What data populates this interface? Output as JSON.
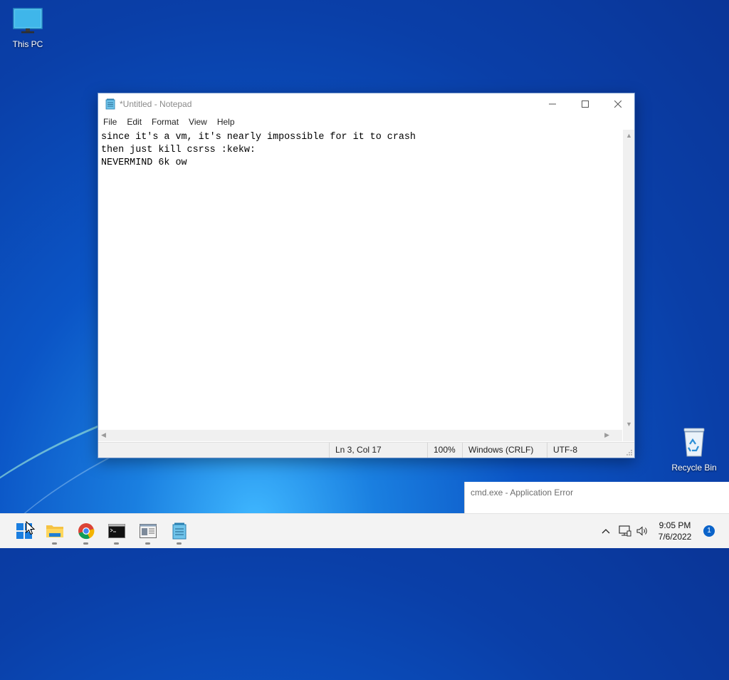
{
  "desktop": {
    "icons": [
      {
        "label": "This PC",
        "icon": "computer-monitor-icon"
      },
      {
        "label": "Recycle Bin",
        "icon": "recycle-bin-icon"
      }
    ]
  },
  "notepad": {
    "title": "*Untitled - Notepad",
    "menu": [
      "File",
      "Edit",
      "Format",
      "View",
      "Help"
    ],
    "lines": [
      "since it's a vm, it's nearly impossible for it to crash",
      "then just kill csrss :kekw:",
      "NEVERMIND 6k ow"
    ],
    "status": {
      "position": "Ln 3, Col 17",
      "zoom": "100%",
      "line_ending": "Windows (CRLF)",
      "encoding": "UTF-8"
    }
  },
  "toast": {
    "text": "cmd.exe - Application Error"
  },
  "taskbar": {
    "apps": [
      {
        "name": "start",
        "icon": "windows-start-icon"
      },
      {
        "name": "file-explorer",
        "icon": "folder-icon"
      },
      {
        "name": "chrome",
        "icon": "chrome-icon"
      },
      {
        "name": "command-prompt",
        "icon": "terminal-icon"
      },
      {
        "name": "control-panel",
        "icon": "window-app-icon"
      },
      {
        "name": "notepad",
        "icon": "notepad-icon"
      }
    ],
    "clock": {
      "time": "9:05 PM",
      "date": "7/6/2022"
    },
    "notification_count": "1"
  },
  "colors": {
    "accent": "#0a63c9",
    "desktop_blue": "#0b55c6"
  }
}
